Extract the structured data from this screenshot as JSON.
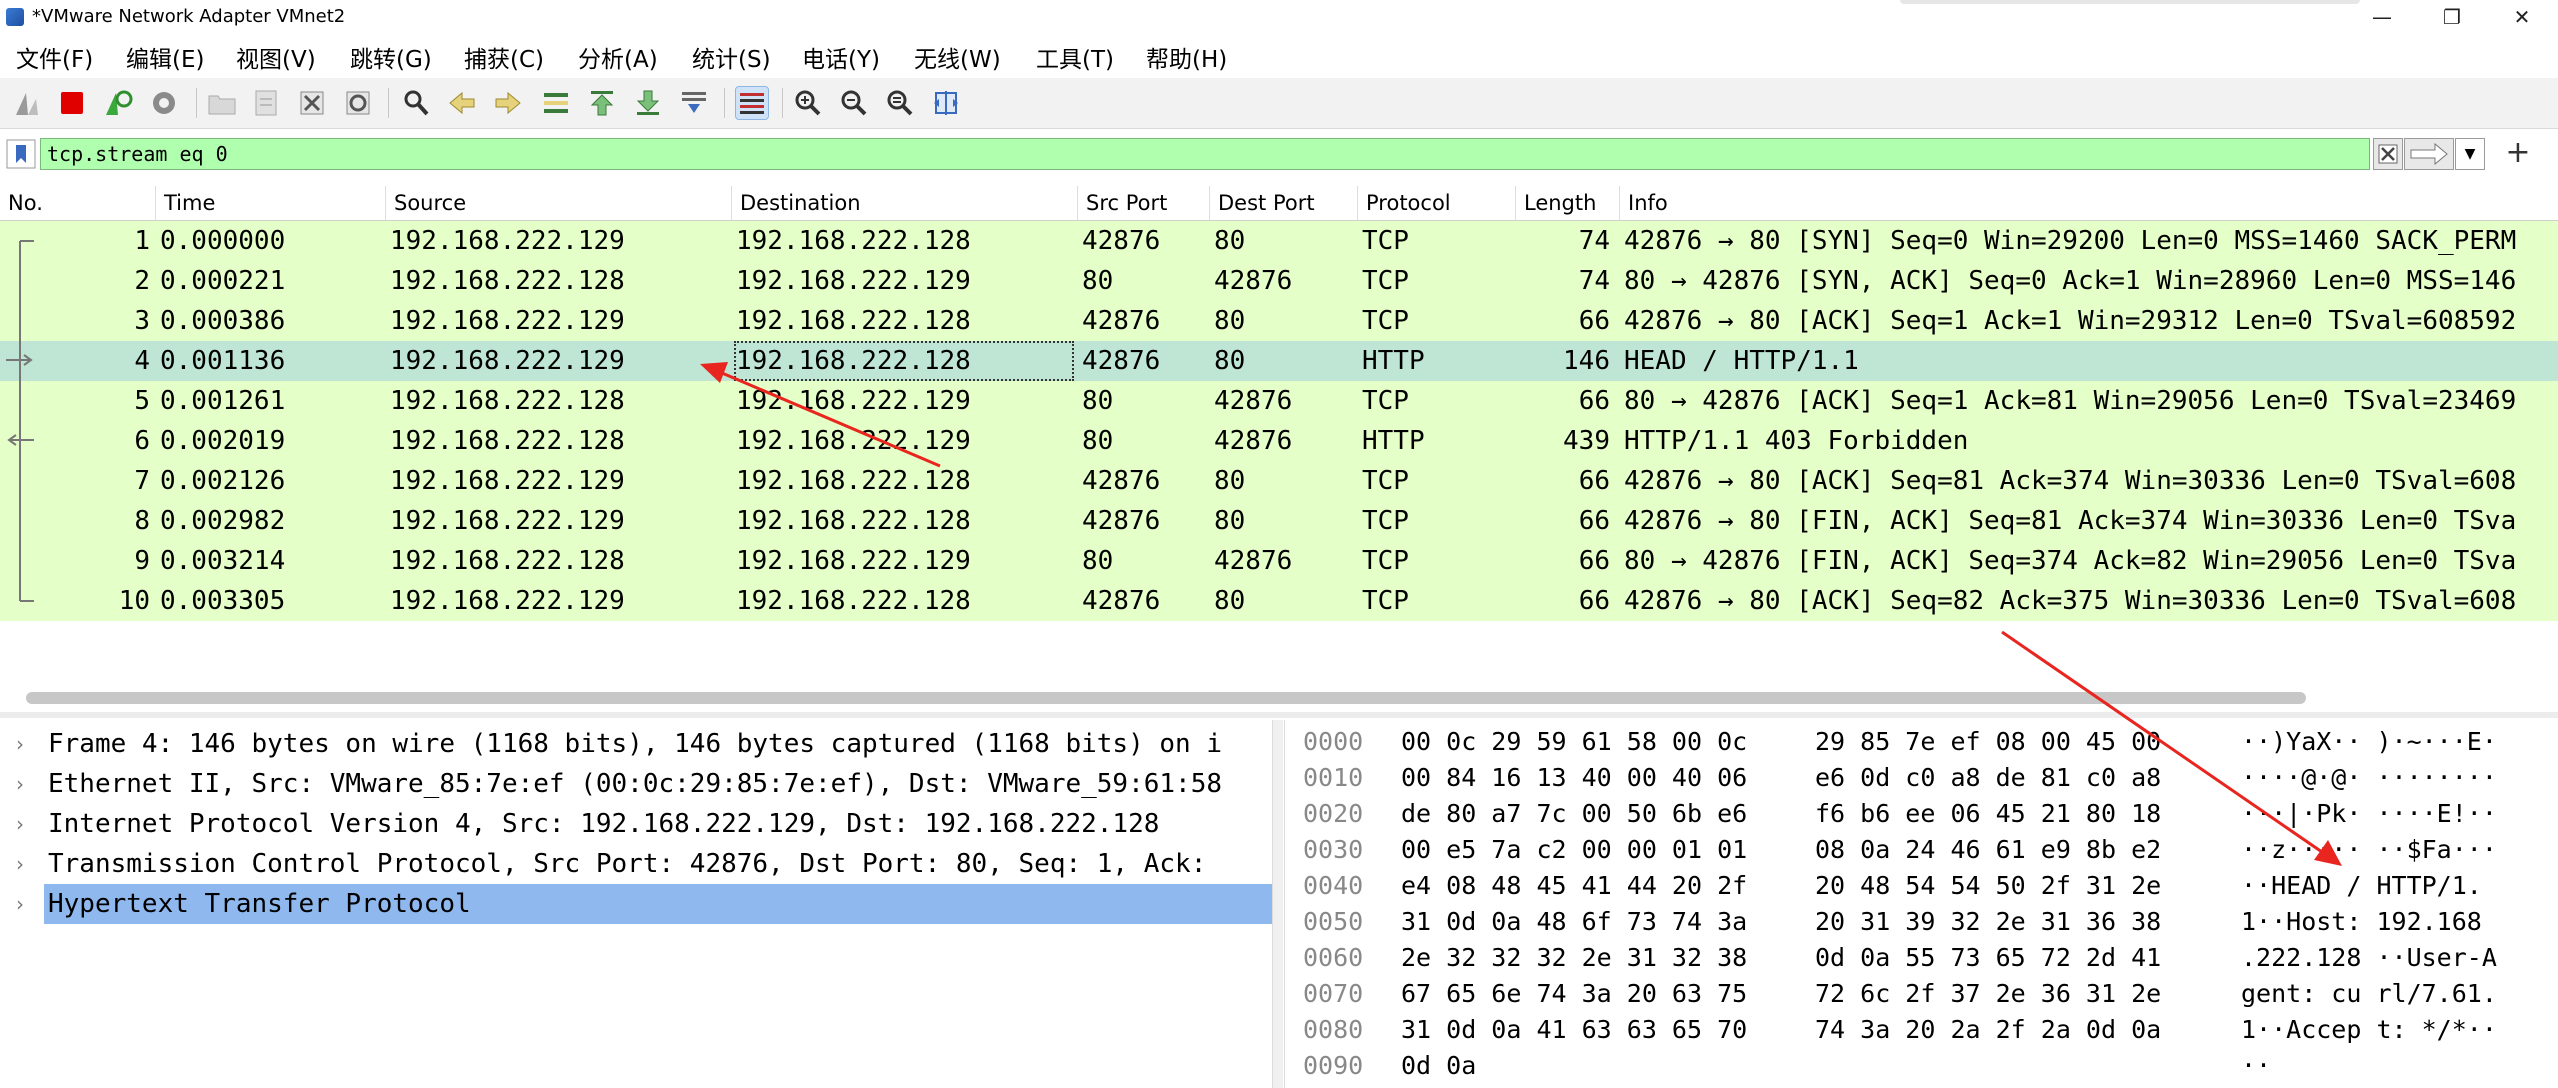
{
  "window": {
    "title": "*VMware Network Adapter VMnet2",
    "minimize": "—",
    "maximize": "❐",
    "close": "✕"
  },
  "menu": [
    "文件(F)",
    "编辑(E)",
    "视图(V)",
    "跳转(G)",
    "捕获(C)",
    "分析(A)",
    "统计(S)",
    "电话(Y)",
    "无线(W)",
    "工具(T)",
    "帮助(H)"
  ],
  "toolbar_icons": [
    "shark-fin-icon",
    "stop-capture-icon",
    "restart-capture-icon",
    "capture-options-icon",
    "open-file-icon",
    "save-file-icon",
    "close-file-icon",
    "reload-file-icon",
    "find-packet-icon",
    "go-back-icon",
    "go-forward-icon",
    "go-to-packet-icon",
    "go-first-icon",
    "go-last-icon",
    "autoscroll-icon",
    "colorize-icon",
    "zoom-in-icon",
    "zoom-out-icon",
    "zoom-normal-icon",
    "resize-columns-icon"
  ],
  "filter": {
    "value": "tcp.stream eq 0"
  },
  "columns": [
    "No.",
    "Time",
    "Source",
    "Destination",
    "Src Port",
    "Dest Port",
    "Protocol",
    "Length",
    "Info"
  ],
  "packets": [
    {
      "no": "1",
      "time": "0.000000",
      "src": "192.168.222.129",
      "dst": "192.168.222.128",
      "sport": "42876",
      "dport": "80",
      "proto": "TCP",
      "len": "74",
      "info": "42876 → 80 [SYN] Seq=0 Win=29200 Len=0 MSS=1460 SACK_PERM"
    },
    {
      "no": "2",
      "time": "0.000221",
      "src": "192.168.222.128",
      "dst": "192.168.222.129",
      "sport": "80",
      "dport": "42876",
      "proto": "TCP",
      "len": "74",
      "info": "80 → 42876 [SYN, ACK] Seq=0 Ack=1 Win=28960 Len=0 MSS=146"
    },
    {
      "no": "3",
      "time": "0.000386",
      "src": "192.168.222.129",
      "dst": "192.168.222.128",
      "sport": "42876",
      "dport": "80",
      "proto": "TCP",
      "len": "66",
      "info": "42876 → 80 [ACK] Seq=1 Ack=1 Win=29312 Len=0 TSval=608592"
    },
    {
      "no": "4",
      "time": "0.001136",
      "src": "192.168.222.129",
      "dst": "192.168.222.128",
      "sport": "42876",
      "dport": "80",
      "proto": "HTTP",
      "len": "146",
      "info": "HEAD / HTTP/1.1"
    },
    {
      "no": "5",
      "time": "0.001261",
      "src": "192.168.222.128",
      "dst": "192.168.222.129",
      "sport": "80",
      "dport": "42876",
      "proto": "TCP",
      "len": "66",
      "info": "80 → 42876 [ACK] Seq=1 Ack=81 Win=29056 Len=0 TSval=23469"
    },
    {
      "no": "6",
      "time": "0.002019",
      "src": "192.168.222.128",
      "dst": "192.168.222.129",
      "sport": "80",
      "dport": "42876",
      "proto": "HTTP",
      "len": "439",
      "info": "HTTP/1.1 403 Forbidden"
    },
    {
      "no": "7",
      "time": "0.002126",
      "src": "192.168.222.129",
      "dst": "192.168.222.128",
      "sport": "42876",
      "dport": "80",
      "proto": "TCP",
      "len": "66",
      "info": "42876 → 80 [ACK] Seq=81 Ack=374 Win=30336 Len=0 TSval=608"
    },
    {
      "no": "8",
      "time": "0.002982",
      "src": "192.168.222.129",
      "dst": "192.168.222.128",
      "sport": "42876",
      "dport": "80",
      "proto": "TCP",
      "len": "66",
      "info": "42876 → 80 [FIN, ACK] Seq=81 Ack=374 Win=30336 Len=0 TSva"
    },
    {
      "no": "9",
      "time": "0.003214",
      "src": "192.168.222.128",
      "dst": "192.168.222.129",
      "sport": "80",
      "dport": "42876",
      "proto": "TCP",
      "len": "66",
      "info": "80 → 42876 [FIN, ACK] Seq=374 Ack=82 Win=29056 Len=0 TSva"
    },
    {
      "no": "10",
      "time": "0.003305",
      "src": "192.168.222.129",
      "dst": "192.168.222.128",
      "sport": "42876",
      "dport": "80",
      "proto": "TCP",
      "len": "66",
      "info": "42876 → 80 [ACK] Seq=82 Ack=375 Win=30336 Len=0 TSval=608"
    }
  ],
  "selected_packet": "4",
  "details": [
    {
      "text": "Frame 4: 146 bytes on wire (1168 bits), 146 bytes captured (1168 bits) on i"
    },
    {
      "text": "Ethernet II, Src: VMware_85:7e:ef (00:0c:29:85:7e:ef), Dst: VMware_59:61:58"
    },
    {
      "text": "Internet Protocol Version 4, Src: 192.168.222.129, Dst: 192.168.222.128"
    },
    {
      "text": "Transmission Control Protocol, Src Port: 42876, Dst Port: 80, Seq: 1, Ack:"
    },
    {
      "text": "Hypertext Transfer Protocol"
    }
  ],
  "selected_detail": "Hypertext Transfer Protocol",
  "bytes": [
    {
      "off": "0000",
      "hex1": "00 0c 29 59 61 58 00 0c",
      "hex2": "29 85 7e ef 08 00 45 00",
      "ascii": "··)YaX·· )·~···E·"
    },
    {
      "off": "0010",
      "hex1": "00 84 16 13 40 00 40 06",
      "hex2": "e6 0d c0 a8 de 81 c0 a8",
      "ascii": "····@·@· ········"
    },
    {
      "off": "0020",
      "hex1": "de 80 a7 7c 00 50 6b e6",
      "hex2": "f6 b6 ee 06 45 21 80 18",
      "ascii": "···|·Pk· ····E!··"
    },
    {
      "off": "0030",
      "hex1": "00 e5 7a c2 00 00 01 01",
      "hex2": "08 0a 24 46 61 e9 8b e2",
      "ascii": "··z····· ··$Fa···"
    },
    {
      "off": "0040",
      "hex1": "e4 08 48 45 41 44 20 2f",
      "hex2": "20 48 54 54 50 2f 31 2e",
      "ascii": "··HEAD /  HTTP/1."
    },
    {
      "off": "0050",
      "hex1": "31 0d 0a 48 6f 73 74 3a",
      "hex2": "20 31 39 32 2e 31 36 38",
      "ascii": "1··Host:  192.168"
    },
    {
      "off": "0060",
      "hex1": "2e 32 32 32 2e 31 32 38",
      "hex2": "0d 0a 55 73 65 72 2d 41",
      "ascii": ".222.128 ··User-A"
    },
    {
      "off": "0070",
      "hex1": "67 65 6e 74 3a 20 63 75",
      "hex2": "72 6c 2f 37 2e 36 31 2e",
      "ascii": "gent: cu rl/7.61."
    },
    {
      "off": "0080",
      "hex1": "31 0d 0a 41 63 63 65 70",
      "hex2": "74 3a 20 2a 2f 2a 0d 0a",
      "ascii": "1··Accep t: */*··"
    },
    {
      "off": "0090",
      "hex1": "0d 0a",
      "hex2": "",
      "ascii": "··"
    }
  ],
  "colors": {
    "row_tcp_bg": "#e4ffc7",
    "row_selected_bg": "#bfe6d4",
    "detail_selected_bg": "#8fb8ee",
    "filter_valid_bg": "#afffaf",
    "annotation_arrow": "#e8261f"
  }
}
